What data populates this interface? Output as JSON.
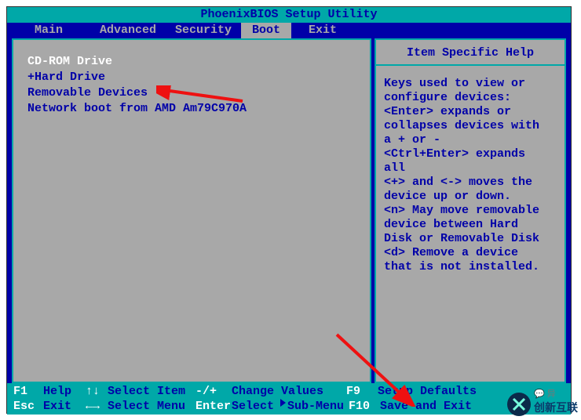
{
  "title": "PhoenixBIOS Setup Utility",
  "tabs": {
    "main": "Main",
    "advanced": "Advanced",
    "security": "Security",
    "boot": "Boot",
    "exit": "Exit"
  },
  "activeTab": "Boot",
  "boot": {
    "items": [
      {
        "label": "CD-ROM Drive",
        "selected": true
      },
      {
        "label": "+Hard Drive",
        "selected": false
      },
      {
        "label": "Removable Devices",
        "selected": false
      },
      {
        "label": "Network boot from AMD Am79C970A",
        "selected": false
      }
    ]
  },
  "help": {
    "title": "Item Specific Help",
    "body": "Keys used to view or\nconfigure devices:\n<Enter> expands or\ncollapses devices with\na + or -\n<Ctrl+Enter> expands\nall\n<+> and <-> moves the\ndevice up or down.\n<n> May move removable\ndevice between Hard\nDisk or Removable Disk\n<d> Remove a device\nthat is not installed."
  },
  "helpbar": {
    "f1": "F1",
    "f1_label": "Help",
    "updown": "↑↓",
    "updown_label": "Select Item",
    "plusminus": "-/+",
    "plusminus_label": "Change Values",
    "f9": "F9",
    "f9_label": "Setup Defaults",
    "esc": "Esc",
    "esc_label": "Exit",
    "leftright": "←→",
    "leftright_label": "Select Menu",
    "enter": "Enter",
    "enter_label_a": "Select",
    "enter_label_b": "Sub-Menu",
    "f10": "F10",
    "f10_label": "Save and Exit"
  },
  "watermark_cn": "创新互联",
  "watermark_sub": "异"
}
